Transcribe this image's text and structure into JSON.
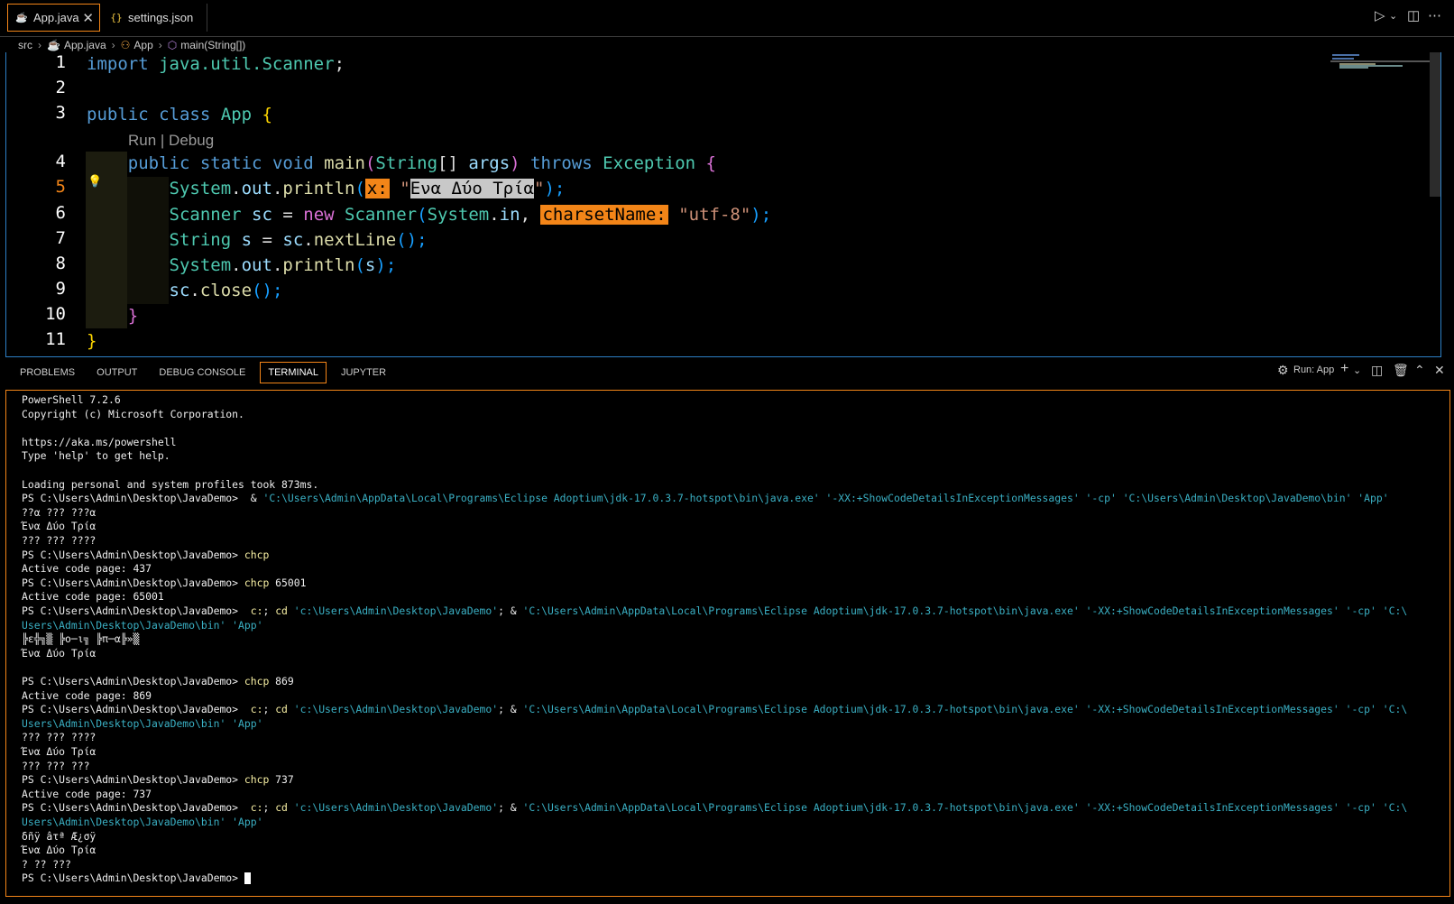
{
  "tabs": [
    {
      "label": "App.java",
      "icon": "java-file-icon",
      "active": true
    },
    {
      "label": "settings.json",
      "icon": "json-file-icon",
      "active": false
    }
  ],
  "breadcrumb": [
    "src",
    "App.java",
    "App",
    "main(String[])"
  ],
  "editor": {
    "line_numbers": [
      "1",
      "2",
      "3",
      "4",
      "5",
      "6",
      "7",
      "8",
      "9",
      "10",
      "11"
    ],
    "codelens": "Run | Debug",
    "lines": {
      "l1": {
        "kw": "import",
        "pkg": "java.util.",
        "cls": "Scanner",
        "end": ";"
      },
      "l3": {
        "kw1": "public",
        "kw2": "class",
        "name": "App",
        "brace": "{"
      },
      "l4": {
        "kw1": "public",
        "kw2": "static",
        "kw3": "void",
        "fn": "main",
        "p1": "(",
        "type": "String",
        "arr": "[]",
        "arg": "args",
        "p2": ")",
        "throws": "throws",
        "exc": "Exception",
        "brace": "{"
      },
      "l5": {
        "obj": "System",
        "dot1": ".",
        "out": "out",
        "dot2": ".",
        "fn": "println",
        "p1": "(",
        "hint": "x:",
        "q1": "\"",
        "str": "Ενα Δύο Τρία",
        "q2": "\"",
        "p2": ");"
      },
      "l6": {
        "type": "Scanner",
        "var": "sc",
        "eq": " = ",
        "kw": "new",
        "cls": "Scanner",
        "p1": "(",
        "obj": "System",
        "dot": ".",
        "in": "in",
        "comma": ", ",
        "hint": "charsetName:",
        "str": "\"utf-8\"",
        "p2": ");"
      },
      "l7": {
        "type": "String",
        "var": "s",
        "eq": " = ",
        "obj": "sc",
        "dot": ".",
        "fn": "nextLine",
        "call": "();"
      },
      "l8": {
        "obj": "System",
        "dot1": ".",
        "out": "out",
        "dot2": ".",
        "fn": "println",
        "p1": "(",
        "arg": "s",
        "p2": ");"
      },
      "l9": {
        "obj": "sc",
        "dot": ".",
        "fn": "close",
        "call": "();"
      },
      "l10": {
        "brace": "}"
      },
      "l11": {
        "brace": "}"
      }
    }
  },
  "panel": {
    "tabs": [
      "PROBLEMS",
      "OUTPUT",
      "DEBUG CONSOLE",
      "TERMINAL",
      "JUPYTER"
    ],
    "active_tab": "TERMINAL",
    "run_label": "Run: App"
  },
  "terminal": {
    "prompt": "PS C:\\Users\\Admin\\Desktop\\JavaDemo> ",
    "lines": [
      {
        "t": "PowerShell 7.2.6"
      },
      {
        "t": "Copyright (c) Microsoft Corporation."
      },
      {
        "t": ""
      },
      {
        "t": "https://aka.ms/powershell"
      },
      {
        "t": "Type 'help' to get help."
      },
      {
        "t": ""
      },
      {
        "t": "Loading personal and system profiles took 873ms."
      },
      {
        "p": true,
        "amp": " & ",
        "arg": "'C:\\Users\\Admin\\AppData\\Local\\Programs\\Eclipse Adoptium\\jdk-17.0.3.7-hotspot\\bin\\java.exe' '-XX:+ShowCodeDetailsInExceptionMessages' '-cp' 'C:\\Users\\Admin\\Desktop\\JavaDemo\\bin' 'App'"
      },
      {
        "t": "??α ??? ???α"
      },
      {
        "t": "Ένα Δύο Τρία"
      },
      {
        "t": "??? ??? ????"
      },
      {
        "p": true,
        "cmd": "chcp"
      },
      {
        "t": "Active code page: 437"
      },
      {
        "p": true,
        "cmd": "chcp",
        "rest": " 65001"
      },
      {
        "t": "Active code page: 65001"
      },
      {
        "p": true,
        "cmd": " c:",
        "amp2": "; ",
        "cmd2": "cd",
        "arg": " 'c:\\Users\\Admin\\Desktop\\JavaDemo'",
        "amp": "; & ",
        "arg2": "'C:\\Users\\Admin\\AppData\\Local\\Programs\\Eclipse Adoptium\\jdk-17.0.3.7-hotspot\\bin\\java.exe' '-XX:+ShowCodeDetailsInExceptionMessages' '-cp' 'C:\\"
      },
      {
        "a": "Users\\Admin\\Desktop\\JavaDemo\\bin' 'App'"
      },
      {
        "t": "╠ε╬╗▒ ╠ο─ι╗ ╠π─α╠»▒"
      },
      {
        "t": "Ένα Δύο Τρία"
      },
      {
        "t": ""
      },
      {
        "p": true,
        "cmd": "chcp",
        "rest": " 869"
      },
      {
        "t": "Active code page: 869"
      },
      {
        "p": true,
        "cmd": " c:",
        "amp2": "; ",
        "cmd2": "cd",
        "arg": " 'c:\\Users\\Admin\\Desktop\\JavaDemo'",
        "amp": "; & ",
        "arg2": "'C:\\Users\\Admin\\AppData\\Local\\Programs\\Eclipse Adoptium\\jdk-17.0.3.7-hotspot\\bin\\java.exe' '-XX:+ShowCodeDetailsInExceptionMessages' '-cp' 'C:\\"
      },
      {
        "a": "Users\\Admin\\Desktop\\JavaDemo\\bin' 'App'"
      },
      {
        "t": "??? ??? ????"
      },
      {
        "t": "Ένα Δύο Τρία"
      },
      {
        "t": "??? ??? ???"
      },
      {
        "p": true,
        "cmd": "chcp",
        "rest": " 737"
      },
      {
        "t": "Active code page: 737"
      },
      {
        "p": true,
        "cmd": " c:",
        "amp2": "; ",
        "cmd2": "cd",
        "arg": " 'c:\\Users\\Admin\\Desktop\\JavaDemo'",
        "amp": "; & ",
        "arg2": "'C:\\Users\\Admin\\AppData\\Local\\Programs\\Eclipse Adoptium\\jdk-17.0.3.7-hotspot\\bin\\java.exe' '-XX:+ShowCodeDetailsInExceptionMessages' '-cp' 'C:\\"
      },
      {
        "a": "Users\\Admin\\Desktop\\JavaDemo\\bin' 'App'"
      },
      {
        "t": "δñÿ âτª Æ¿σÿ"
      },
      {
        "t": "Ένα Δύο Τρία"
      },
      {
        "t": "? ?? ???"
      },
      {
        "p": true,
        "cursor": true
      }
    ]
  },
  "colors": {
    "accent": "#f38518",
    "focus_border": "#2d7fc5",
    "terminal_cmd": "#f9f1a5",
    "terminal_arg": "#3ab0c4"
  }
}
